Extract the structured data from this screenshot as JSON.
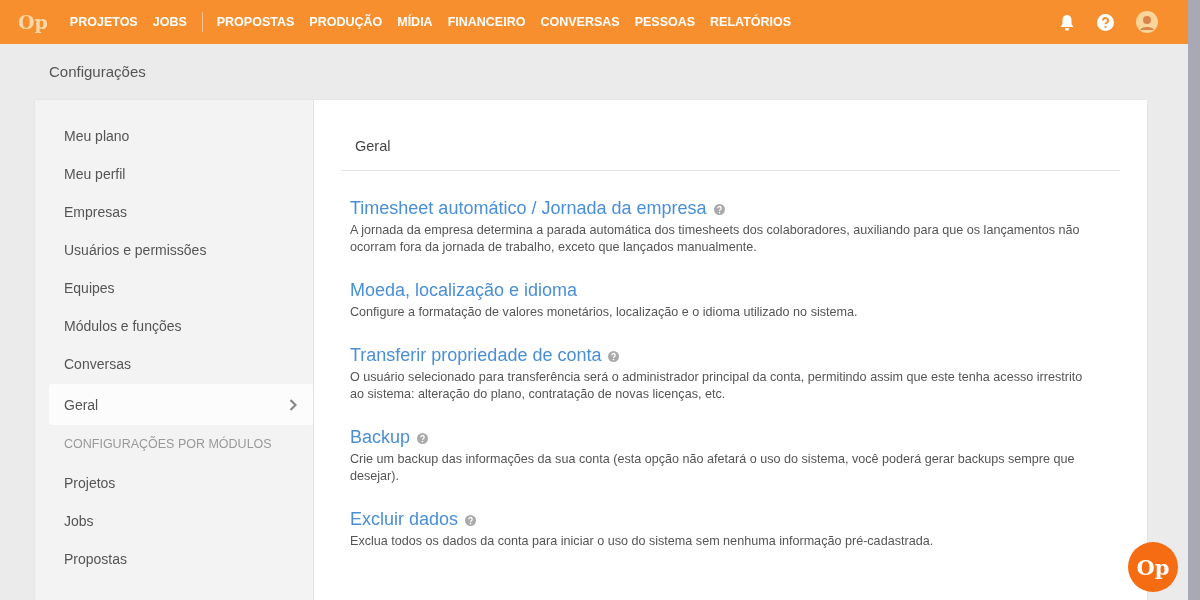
{
  "topbar": {
    "logo": "Op",
    "nav": [
      {
        "label": "PROJETOS",
        "divider_after": false
      },
      {
        "label": "JOBS",
        "divider_after": true
      },
      {
        "label": "PROPOSTAS",
        "divider_after": false
      },
      {
        "label": "PRODUÇÃO",
        "divider_after": false
      },
      {
        "label": "MÍDIA",
        "divider_after": false
      },
      {
        "label": "FINANCEIRO",
        "divider_after": false
      },
      {
        "label": "CONVERSAS",
        "divider_after": false
      },
      {
        "label": "PESSOAS",
        "divider_after": false
      },
      {
        "label": "RELATÓRIOS",
        "divider_after": false
      }
    ]
  },
  "page_title": "Configurações",
  "sidebar": {
    "items": [
      {
        "kind": "item",
        "label": "Meu plano",
        "selected": false
      },
      {
        "kind": "item",
        "label": "Meu perfil",
        "selected": false
      },
      {
        "kind": "item",
        "label": "Empresas",
        "selected": false
      },
      {
        "kind": "item",
        "label": "Usuários e permissões",
        "selected": false
      },
      {
        "kind": "item",
        "label": "Equipes",
        "selected": false
      },
      {
        "kind": "item",
        "label": "Módulos e funções",
        "selected": false
      },
      {
        "kind": "item",
        "label": "Conversas",
        "selected": false
      },
      {
        "kind": "item",
        "label": "Geral",
        "selected": true
      },
      {
        "kind": "heading",
        "label": "CONFIGURAÇÕES POR MÓDULOS"
      },
      {
        "kind": "item",
        "label": "Projetos",
        "selected": false
      },
      {
        "kind": "item",
        "label": "Jobs",
        "selected": false
      },
      {
        "kind": "item",
        "label": "Propostas",
        "selected": false
      }
    ]
  },
  "content": {
    "heading": "Geral",
    "sections": [
      {
        "title": "Timesheet automático / Jornada da empresa",
        "help": true,
        "description": "A jornada da empresa determina a parada automática dos timesheets dos colaboradores, auxiliando para que os lançamentos não ocorram fora da jornada de trabalho, exceto que lançados manualmente."
      },
      {
        "title": "Moeda, localização e idioma",
        "help": false,
        "description": "Configure a formatação de valores monetários, localização e o idioma utilizado no sistema."
      },
      {
        "title": "Transferir propriedade de conta",
        "help": true,
        "description": "O usuário selecionado para transferência será o administrador principal da conta, permitindo assim que este tenha acesso irrestrito ao sistema: alteração do plano, contratação de novas licenças, etc."
      },
      {
        "title": "Backup",
        "help": true,
        "description": "Crie um backup das informações da sua conta (esta opção não afetará o uso do sistema, você poderá gerar backups sempre que desejar)."
      },
      {
        "title": "Excluir dados",
        "help": true,
        "description": "Exclua todos os dados da conta para iniciar o uso do sistema sem nenhuma informação pré-cadastrada."
      }
    ]
  },
  "chat_button": "Op"
}
